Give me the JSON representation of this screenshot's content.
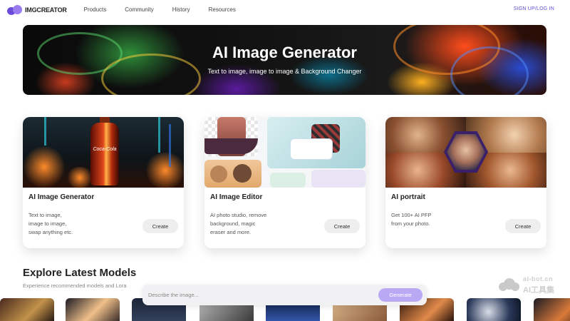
{
  "nav": {
    "logo_text": "IMGCREATOR",
    "links": [
      "Products",
      "Community",
      "History",
      "Resources"
    ],
    "auth_label": "SIGN UP/LOG IN"
  },
  "hero": {
    "title": "AI Image Generator",
    "subtitle": "Text to image, image to image & Background Changer"
  },
  "cards": [
    {
      "title": "AI Image Generator",
      "desc": [
        "Text to image,",
        "image to image,",
        "swap anything etc."
      ],
      "button": "Create",
      "image_label": "Coca-Cola"
    },
    {
      "title": "AI Image Editor",
      "desc": [
        "AI photo studio, remove",
        "background, magic",
        "eraser and more."
      ],
      "button": "Create"
    },
    {
      "title": "AI portrait",
      "desc": [
        "Get 100+ AI PFP",
        "from your photo."
      ],
      "button": "Create"
    }
  ],
  "explore": {
    "title": "Explore Latest Models",
    "subtitle": "Experience recommended models and Lora"
  },
  "prompt": {
    "placeholder": "Describe the image...",
    "button": "Generate"
  },
  "watermark": {
    "top": "ai-bot.cn",
    "bottom": "AI工具集"
  },
  "colors": {
    "accent": "#5b4fd6",
    "generate_button": "#b9a9f5",
    "create_button": "#eeeeef"
  }
}
